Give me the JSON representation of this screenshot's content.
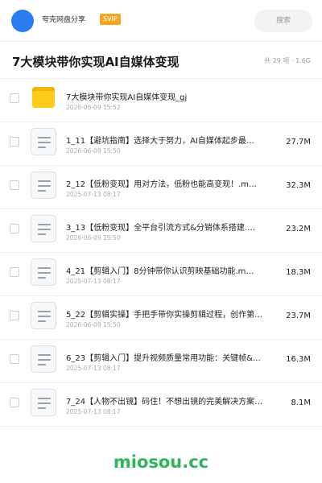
{
  "header": {
    "share_name": "夸克网盘分享",
    "badge": "SVIP",
    "search_placeholder": "搜索"
  },
  "title_row": {
    "title": "7大模块带你实现AI自媒体变现",
    "meta": "共 29 项 · 1.6G"
  },
  "files": [
    {
      "type": "folder",
      "name": "7大模块带你实现AI自媒体变现_gj",
      "date": "2026-06-09 15:52",
      "size": ""
    },
    {
      "type": "file",
      "name": "1_11【避坑指南】选择大于努力，AI自媒体起步最…",
      "date": "2026-06-09 15:50",
      "size": "27.7M"
    },
    {
      "type": "file",
      "name": "2_12【低粉变现】用对方法，低粉也能高变现！.m…",
      "date": "2025-07-13 08:17",
      "size": "32.3M"
    },
    {
      "type": "file",
      "name": "3_13【低粉变现】全平台引流方式&分销体系搭建.…",
      "date": "2026-06-09 15:50",
      "size": "23.2M"
    },
    {
      "type": "file",
      "name": "4_21【剪辑入门】8分钟带你认识剪映基础功能.m…",
      "date": "2025-07-13 08:17",
      "size": "18.3M"
    },
    {
      "type": "file",
      "name": "5_22【剪辑实操】手把手带你实操剪辑过程，创作第…",
      "date": "2026-06-09 15:50",
      "size": "23.7M"
    },
    {
      "type": "file",
      "name": "6_23【剪辑入门】提升视频质量常用功能：关键帧&…",
      "date": "2025-07-13 08:17",
      "size": "16.3M"
    },
    {
      "type": "file",
      "name": "7_24【人物不出镜】码住！不想出镜的完美解决方案…",
      "date": "2025-07-13 08:17",
      "size": "8.1M"
    }
  ],
  "watermark": "miosou.cc",
  "colors": {
    "accent_blue": "#2b7bf3",
    "svip": "#f5a623",
    "folder": "#ffcc1a",
    "watermark": "#2fb45a"
  }
}
